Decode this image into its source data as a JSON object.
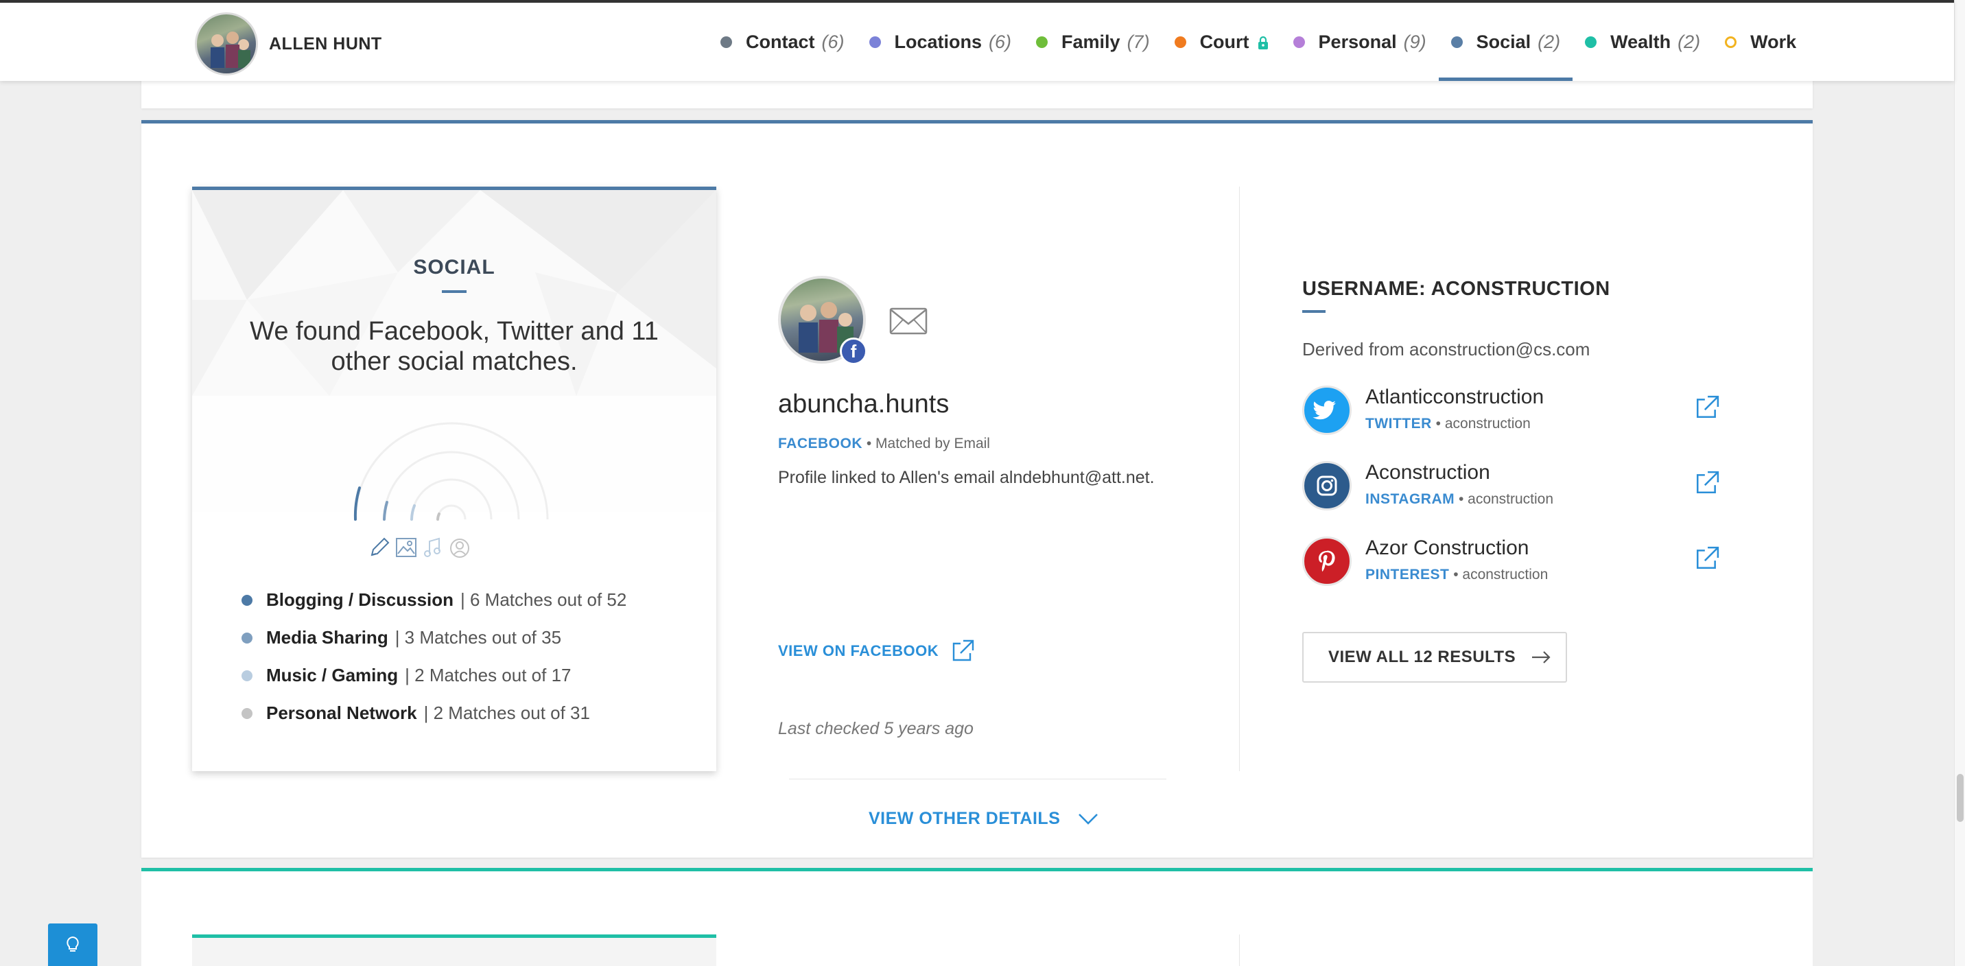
{
  "header": {
    "name": "ALLEN HUNT",
    "nav": [
      {
        "label": "Contact",
        "count": "(6)",
        "color": "#6e7a86"
      },
      {
        "label": "Locations",
        "count": "(6)",
        "color": "#7b82d8"
      },
      {
        "label": "Family",
        "count": "(7)",
        "color": "#6fbe3a"
      },
      {
        "label": "Court",
        "count": "",
        "color": "#f07b1f"
      },
      {
        "label": "Personal",
        "count": "(9)",
        "color": "#b57fd8"
      },
      {
        "label": "Social",
        "count": "(2)",
        "color": "#5a7fa6"
      },
      {
        "label": "Wealth",
        "count": "(2)",
        "color": "#1fbfa6"
      },
      {
        "label": "Work",
        "count": "",
        "color": "#f2b320"
      }
    ],
    "active": "Social"
  },
  "summary": {
    "title": "SOCIAL",
    "text": "We found Facebook, Twitter and 11 other social matches.",
    "categories": [
      {
        "name": "Blogging / Discussion",
        "detail": "| 6 Matches out of 52",
        "color": "#4d7aa6",
        "fraction": 0.115
      },
      {
        "name": "Media Sharing",
        "detail": "| 3 Matches out of 35",
        "color": "#7f9fbf",
        "fraction": 0.086
      },
      {
        "name": "Music / Gaming",
        "detail": "| 2 Matches out of 17",
        "color": "#b9cde0",
        "fraction": 0.118
      },
      {
        "name": "Personal Network",
        "detail": "| 2 Matches out of 31",
        "color": "#c4c4c4",
        "fraction": 0.065
      }
    ],
    "category_icons": [
      "pencil-icon",
      "image-icon",
      "music-note-icon",
      "person-icon"
    ]
  },
  "profile": {
    "handle": "abuncha.hunts",
    "source": "FACEBOOK",
    "match": "Matched by Email",
    "description": "Profile linked to Allen's email alndebhunt@att.net.",
    "view_link": "VIEW ON FACEBOOK",
    "last_checked": "Last checked 5 years ago"
  },
  "username": {
    "title": "USERNAME: ACONSTRUCTION",
    "derived": "Derived from aconstruction@cs.com",
    "accounts": [
      {
        "name": "Atlanticconstruction",
        "platform": "TWITTER",
        "handle": "aconstruction",
        "color": "#1da1f2",
        "icon": "twitter-icon"
      },
      {
        "name": "Aconstruction",
        "platform": "INSTAGRAM",
        "handle": "aconstruction",
        "color": "#2c5b8c",
        "icon": "instagram-icon"
      },
      {
        "name": "Azor Construction",
        "platform": "PINTEREST",
        "handle": "aconstruction",
        "color": "#cc1f27",
        "icon": "pinterest-icon"
      }
    ],
    "view_all": "VIEW ALL 12 RESULTS"
  },
  "footer": {
    "other_details": "VIEW OTHER DETAILS"
  }
}
